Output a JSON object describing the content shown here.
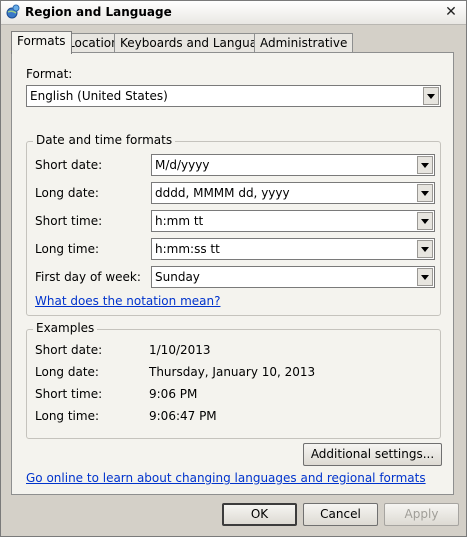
{
  "window": {
    "title": "Region and Language",
    "app_icon": "globe-icon",
    "close_icon": "close-icon"
  },
  "tabs": [
    {
      "label": "Formats",
      "active": true
    },
    {
      "label": "Location",
      "active": false
    },
    {
      "label": "Keyboards and Languages",
      "active": false
    },
    {
      "label": "Administrative",
      "active": false
    }
  ],
  "format": {
    "label": "Format:",
    "value": "English (United States)"
  },
  "datetime": {
    "legend": "Date and time formats",
    "short_date": {
      "label": "Short date:",
      "value": "M/d/yyyy"
    },
    "long_date": {
      "label": "Long date:",
      "value": "dddd, MMMM dd, yyyy"
    },
    "short_time": {
      "label": "Short time:",
      "value": "h:mm tt"
    },
    "long_time": {
      "label": "Long time:",
      "value": "h:mm:ss tt"
    },
    "first_day": {
      "label": "First day of week:",
      "value": "Sunday"
    },
    "notation_link": "What does the notation mean?"
  },
  "examples": {
    "legend": "Examples",
    "rows": [
      {
        "label": "Short date:",
        "value": "1/10/2013"
      },
      {
        "label": "Long date:",
        "value": "Thursday, January 10, 2013"
      },
      {
        "label": "Short time:",
        "value": "9:06 PM"
      },
      {
        "label": "Long time:",
        "value": "9:06:47 PM"
      }
    ]
  },
  "additional_settings": "Additional settings...",
  "online_link": "Go online to learn about changing languages and regional formats",
  "buttons": {
    "ok": "OK",
    "cancel": "Cancel",
    "apply": "Apply"
  }
}
